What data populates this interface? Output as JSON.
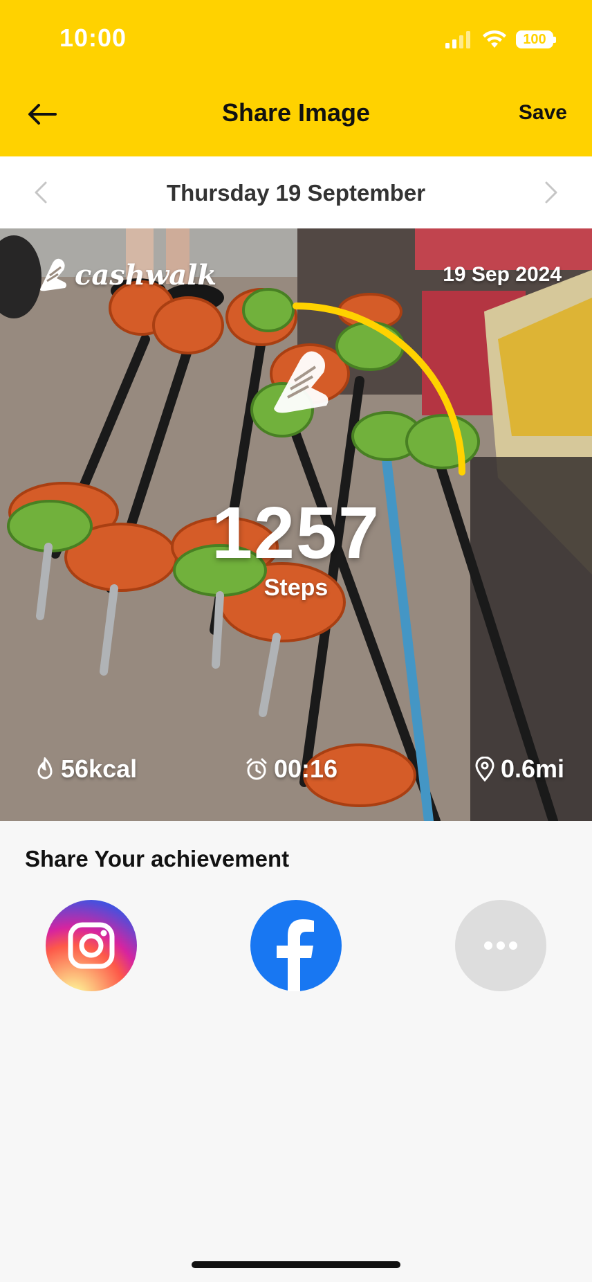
{
  "status_bar": {
    "time": "10:00",
    "battery": "100"
  },
  "nav": {
    "title": "Share Image",
    "save_label": "Save"
  },
  "date_nav": {
    "label": "Thursday 19 September"
  },
  "card": {
    "brand": "cashwalk",
    "date": "19 Sep 2024",
    "steps": "1257",
    "steps_label": "Steps",
    "kcal": "56kcal",
    "duration": "00:16",
    "distance": "0.6mi"
  },
  "share": {
    "title": "Share Your achievement",
    "options": [
      {
        "name": "instagram-icon"
      },
      {
        "name": "facebook-icon"
      },
      {
        "name": "more-icon"
      }
    ]
  },
  "colors": {
    "accent": "#FFD200",
    "facebook": "#1877F2",
    "more": "#dddddd"
  }
}
